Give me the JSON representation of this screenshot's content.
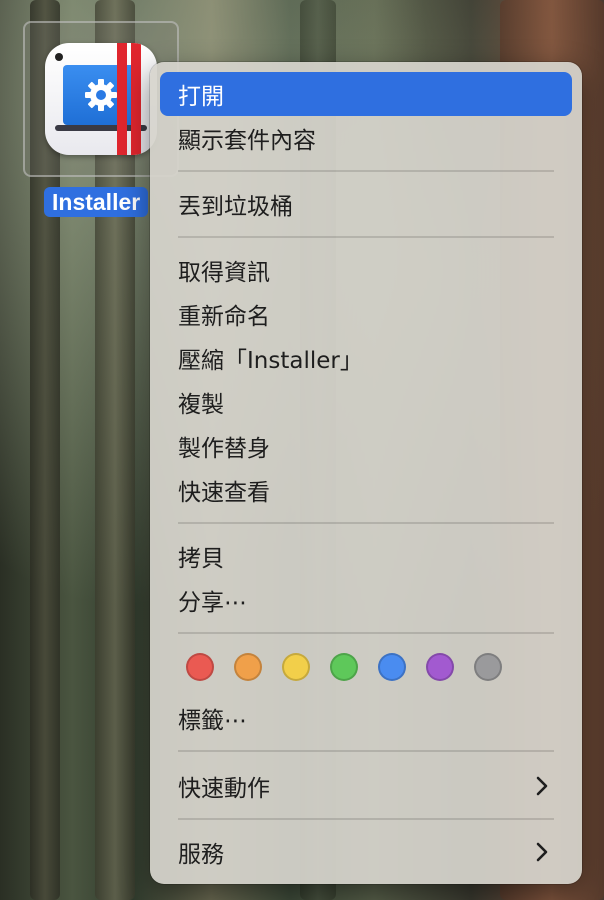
{
  "desktop": {
    "icon_label": "Installer"
  },
  "menu": {
    "open": "打開",
    "show_package_contents": "顯示套件內容",
    "move_to_trash": "丟到垃圾桶",
    "get_info": "取得資訊",
    "rename": "重新命名",
    "compress": "壓縮「Installer」",
    "duplicate": "複製",
    "make_alias": "製作替身",
    "quick_look": "快速查看",
    "copy": "拷貝",
    "share": "分享⋯",
    "tags": "標籤⋯",
    "quick_actions": "快速動作",
    "services": "服務"
  },
  "tag_colors": [
    "#ea5a52",
    "#f0a04a",
    "#f2cf4a",
    "#5ec85a",
    "#4a8cf0",
    "#a25ad0",
    "#9a9a9c"
  ],
  "colors": {
    "highlight": "#2f6fe0"
  }
}
